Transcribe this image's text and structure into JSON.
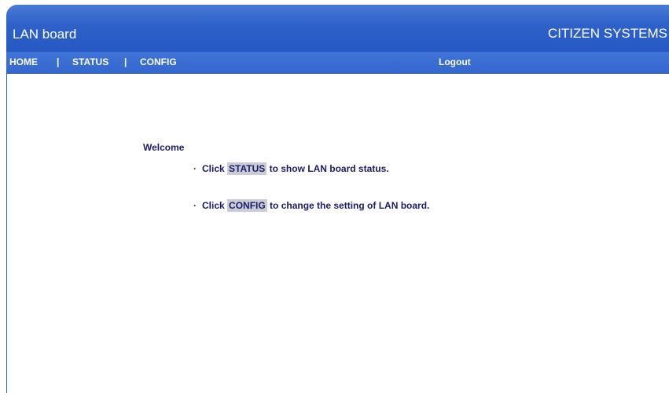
{
  "header": {
    "title": "LAN board",
    "brand": "CITIZEN SYSTEMS"
  },
  "nav": {
    "home": "HOME",
    "separator": "|",
    "status": "STATUS",
    "config": "CONFIG",
    "logout": "Logout"
  },
  "main": {
    "welcome": "Welcome",
    "bullet": "·",
    "status_line": {
      "prefix": "Click",
      "link": "STATUS",
      "suffix": "to show LAN board status."
    },
    "config_line": {
      "prefix": "Click",
      "link": "CONFIG",
      "suffix": "to change the setting of LAN board."
    }
  },
  "colors": {
    "header_blue": "#2f62c9",
    "text_navy": "#1a1a66",
    "link_highlight": "#c9ccd6"
  }
}
